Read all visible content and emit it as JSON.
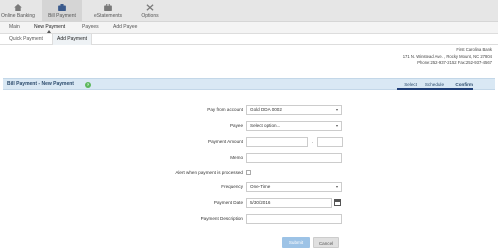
{
  "top_nav": [
    {
      "label": "Online Banking",
      "icon": "home-icon",
      "active": false
    },
    {
      "label": "Bill Payment",
      "icon": "bill-payment-icon",
      "active": true
    },
    {
      "label": "eStatements",
      "icon": "briefcase-icon",
      "active": false
    },
    {
      "label": "Options",
      "icon": "tools-icon",
      "active": false
    }
  ],
  "sub_nav": [
    "Main",
    "New Payment",
    "Payees",
    "Add Payee"
  ],
  "sub_sub_nav": [
    "Quick Payment",
    "Add Payment"
  ],
  "bank_info": {
    "name": "First Carolina Bank",
    "address": "171 N. Winstead Ave. , Rocky Mount, NC 27804",
    "phone": "Phone:252-937-2152 Fax:252-937-4567"
  },
  "section": {
    "title": "Bill Payment - New Payment",
    "help": "?",
    "steps": [
      "Select",
      "Schedule",
      "Confirm"
    ]
  },
  "form": {
    "pay_from_label": "Pay from account",
    "pay_from_value": "Gold DDA 0002",
    "payee_label": "Payee",
    "payee_value": "Select option...",
    "amount_label": "Payment Amount",
    "amount_dollars": "",
    "amount_cents": "",
    "amount_separator": ".",
    "memo_label": "Memo",
    "memo_value": "",
    "alert_label": "Alert when payment is processed",
    "frequency_label": "Frequency",
    "frequency_value": "One-Time",
    "date_label": "Payment Date",
    "date_value": "5/30/2016",
    "description_label": "Payment Description",
    "description_value": ""
  },
  "buttons": {
    "submit": "Submit",
    "cancel": "Cancel"
  },
  "colors": {
    "section_bar": "#d9e8f4",
    "help_badge": "#5cb85c",
    "submit": "#9dc3e6",
    "step_underline": "#1f3f78"
  }
}
